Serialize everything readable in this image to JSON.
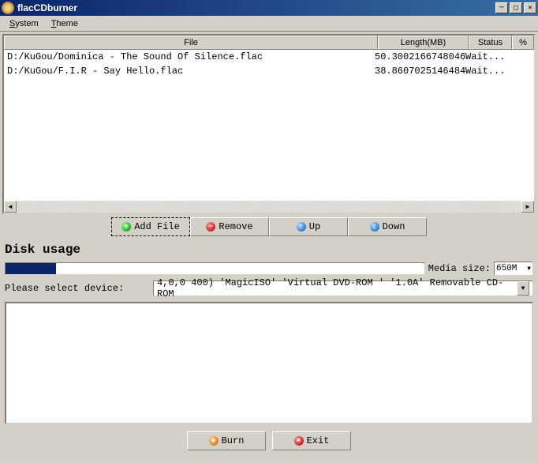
{
  "title": "flacCDburner",
  "menu": {
    "system": "System",
    "theme": "Theme"
  },
  "headers": {
    "file": "File",
    "length": "Length(MB)",
    "status": "Status",
    "pct": "%"
  },
  "files": [
    {
      "path": "D:/KuGou/Dominica - The Sound Of Silence.flac",
      "length": "50.3002166748046",
      "status": "Wait...",
      "pct": ""
    },
    {
      "path": "D:/KuGou/F.I.R - Say Hello.flac",
      "length": "38.8607025146484",
      "status": "Wait...",
      "pct": ""
    }
  ],
  "buttons": {
    "add": "Add File",
    "remove": "Remove",
    "up": "Up",
    "down": "Down",
    "burn": "Burn",
    "exit": "Exit"
  },
  "disk_usage_title": "Disk usage",
  "media_size_label": "Media size:",
  "media_size_value": "650M",
  "device_label": "Please select device:",
  "device_value": "4,0,0   400) 'MagicISO' 'Virtual DVD-ROM ' '1.0A' Removable CD-ROM"
}
